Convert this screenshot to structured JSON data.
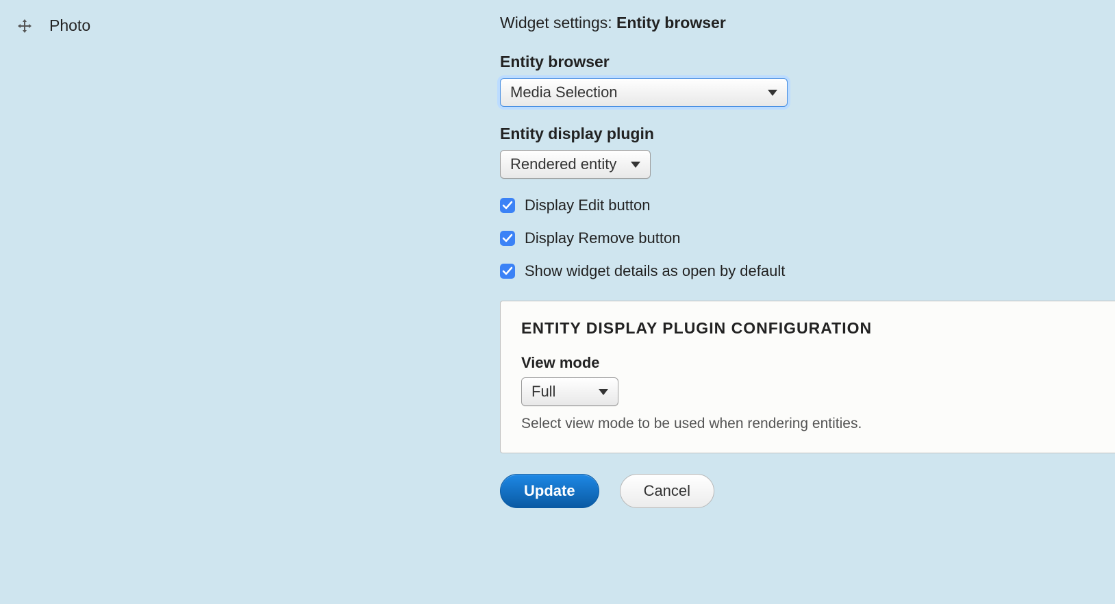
{
  "left": {
    "field_name": "Photo"
  },
  "settings": {
    "title_prefix": "Widget settings: ",
    "title_bold": "Entity browser",
    "entity_browser": {
      "label": "Entity browser",
      "selected": "Media Selection"
    },
    "entity_display_plugin": {
      "label": "Entity display plugin",
      "selected": "Rendered entity"
    },
    "checkboxes": {
      "display_edit": {
        "label": "Display Edit button",
        "checked": true
      },
      "display_remove": {
        "label": "Display Remove button",
        "checked": true
      },
      "show_open": {
        "label": "Show widget details as open by default",
        "checked": true
      }
    },
    "plugin_config": {
      "legend": "Entity display plugin configuration",
      "view_mode": {
        "label": "View mode",
        "selected": "Full",
        "description": "Select view mode to be used when rendering entities."
      }
    },
    "buttons": {
      "update": "Update",
      "cancel": "Cancel"
    }
  }
}
